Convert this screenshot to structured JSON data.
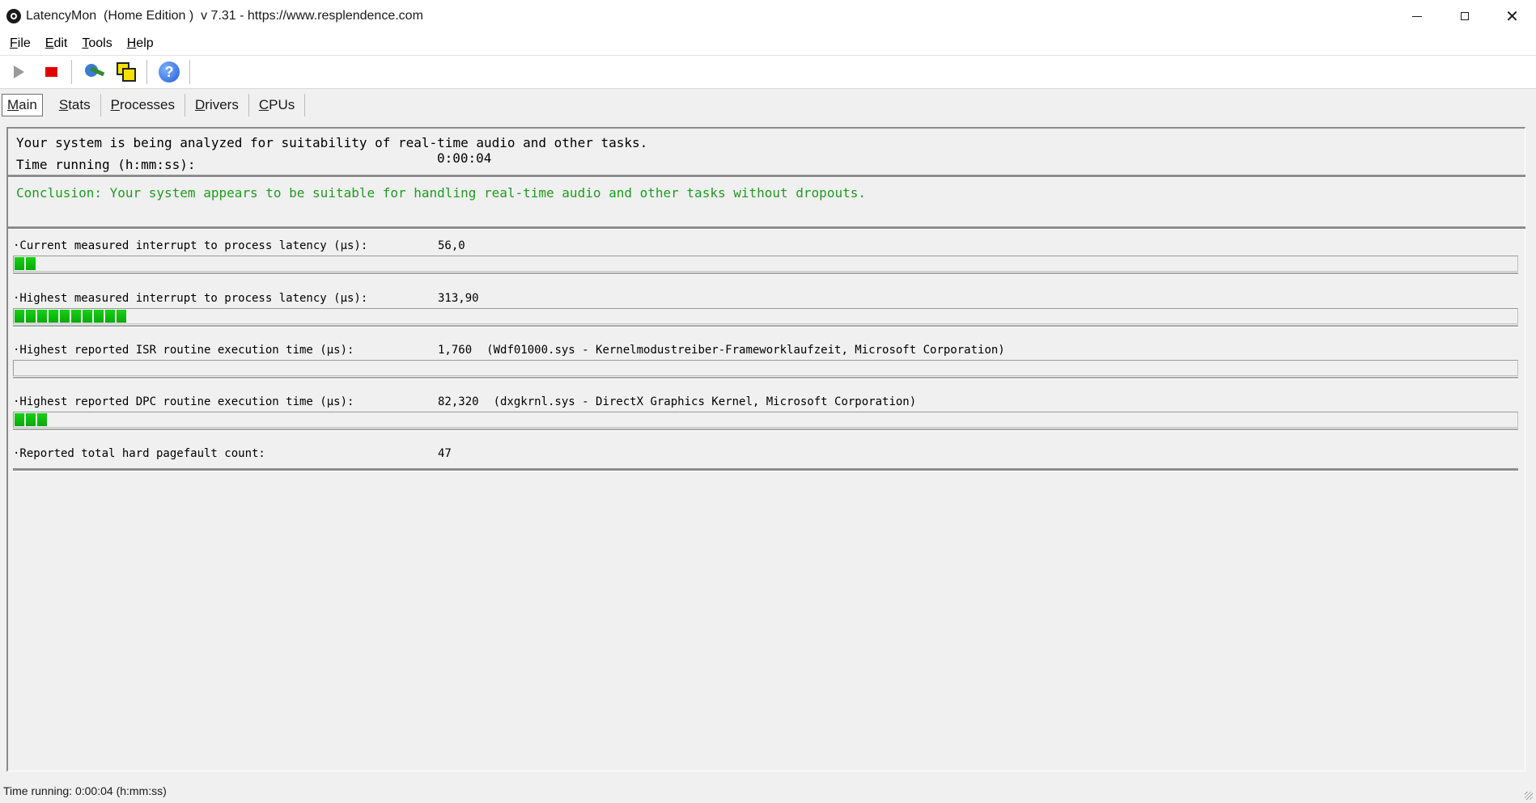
{
  "window": {
    "title": "LatencyMon  (Home Edition )  v 7.31 - https://www.resplendence.com",
    "close_glyph": "✕"
  },
  "menu": [
    "File",
    "Edit",
    "Tools",
    "Help"
  ],
  "toolbar": {
    "icons": [
      "play-icon",
      "stop-icon",
      "reset-icon",
      "windows-icon",
      "help-icon"
    ],
    "help_glyph": "?"
  },
  "tabs": [
    "Main",
    "Stats",
    "Processes",
    "Drivers",
    "CPUs"
  ],
  "main": {
    "status_line": "Your system is being analyzed for suitability of real-time audio and other tasks.",
    "time_label": "Time running (h:mm:ss):",
    "time_value": "0:00:04",
    "conclusion": "Conclusion: Your system appears to be suitable for handling real-time audio and other tasks without dropouts.",
    "conclusion_color": "#1f9c1f",
    "metrics": [
      {
        "label": "·Current measured interrupt to process latency (µs):",
        "value": "56,0",
        "detail": "",
        "bar_segments": 2
      },
      {
        "label": "·Highest measured interrupt to process latency (µs):",
        "value": "313,90",
        "detail": "",
        "bar_segments": 10
      },
      {
        "label": "·Highest reported ISR routine execution time (µs):",
        "value": "1,760",
        "detail": "(Wdf01000.sys - Kernelmodustreiber-Frameworklaufzeit, Microsoft Corporation)",
        "bar_segments": 0
      },
      {
        "label": "·Highest reported DPC routine execution time (µs):",
        "value": "82,320",
        "detail": "(dxgkrnl.sys - DirectX Graphics Kernel, Microsoft Corporation)",
        "bar_segments": 3
      },
      {
        "label": "·Reported total hard pagefault count:",
        "value": "47",
        "detail": "",
        "bar_segments": null
      }
    ]
  },
  "statusbar": {
    "text": "Time running: 0:00:04  (h:mm:ss)"
  },
  "colors": {
    "bar_green": "#0fbf0f",
    "stop_red": "#e00000"
  }
}
